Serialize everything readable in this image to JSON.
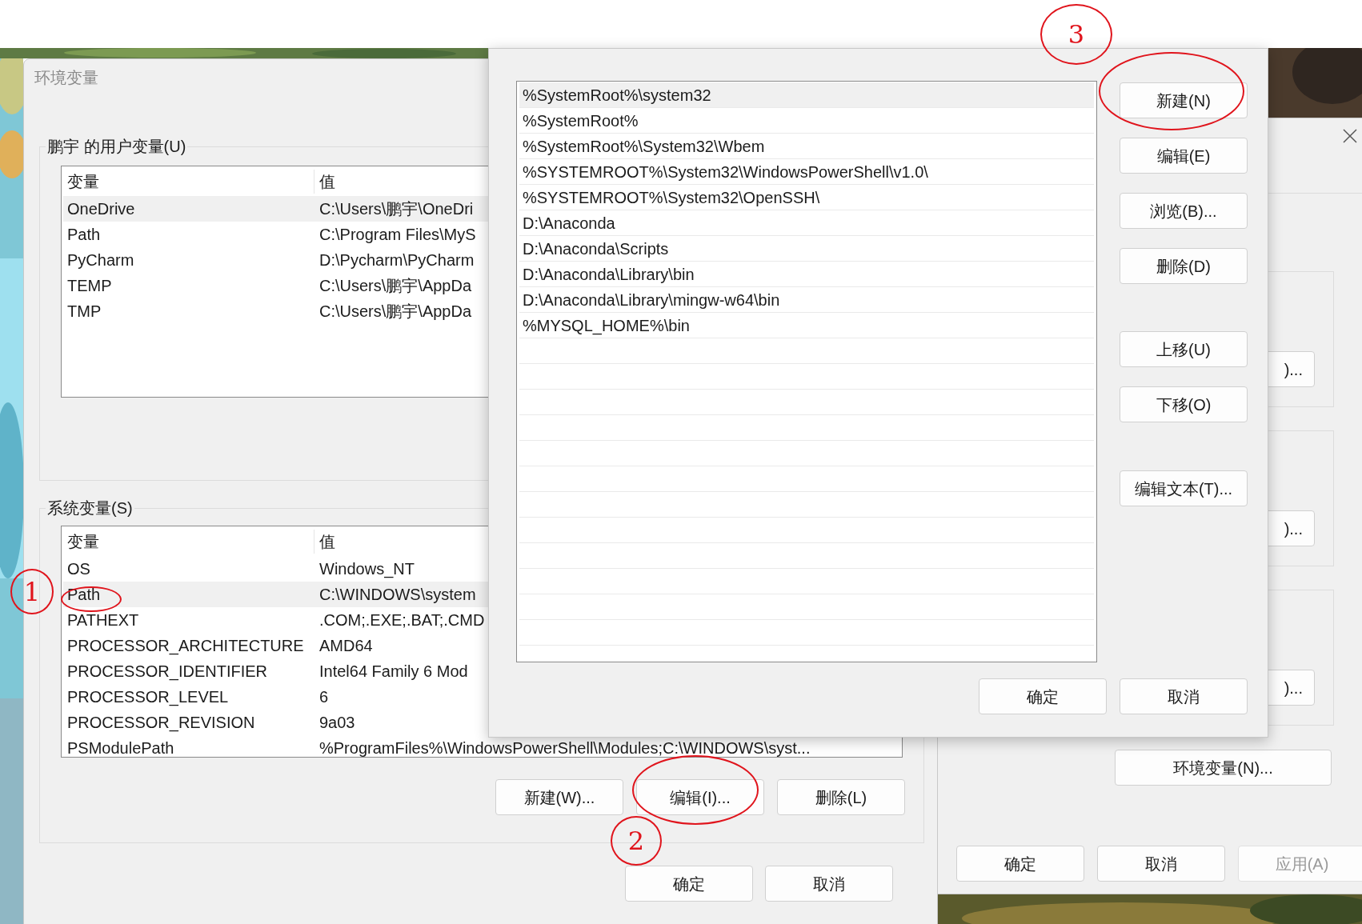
{
  "env_window": {
    "title": "环境变量",
    "user_group": {
      "label": "鹏宇 的用户变量(U)",
      "columns": [
        "变量",
        "值"
      ],
      "rows": [
        {
          "name": "OneDrive",
          "value": "C:\\Users\\鹏宇\\OneDri",
          "selected": true
        },
        {
          "name": "Path",
          "value": "C:\\Program Files\\MyS",
          "selected": false
        },
        {
          "name": "PyCharm",
          "value": "D:\\Pycharm\\PyCharm",
          "selected": false
        },
        {
          "name": "TEMP",
          "value": "C:\\Users\\鹏宇\\AppDa",
          "selected": false
        },
        {
          "name": "TMP",
          "value": "C:\\Users\\鹏宇\\AppDa",
          "selected": false
        }
      ]
    },
    "system_group": {
      "label": "系统变量(S)",
      "columns": [
        "变量",
        "值"
      ],
      "rows": [
        {
          "name": "OS",
          "value": "Windows_NT",
          "selected": false
        },
        {
          "name": "Path",
          "value": "C:\\WINDOWS\\system",
          "selected": true
        },
        {
          "name": "PATHEXT",
          "value": ".COM;.EXE;.BAT;.CMD",
          "selected": false
        },
        {
          "name": "PROCESSOR_ARCHITECTURE",
          "value": "AMD64",
          "selected": false
        },
        {
          "name": "PROCESSOR_IDENTIFIER",
          "value": "Intel64 Family 6 Mod",
          "selected": false
        },
        {
          "name": "PROCESSOR_LEVEL",
          "value": "6",
          "selected": false
        },
        {
          "name": "PROCESSOR_REVISION",
          "value": "9a03",
          "selected": false
        },
        {
          "name": "PSModulePath",
          "value": "%ProgramFiles%\\WindowsPowerShell\\Modules;C:\\WINDOWS\\syst...",
          "selected": false
        }
      ],
      "buttons": [
        "新建(W)...",
        "编辑(I)...",
        "删除(L)"
      ]
    },
    "buttons": [
      "确定",
      "取消"
    ]
  },
  "edit_dialog": {
    "entries": [
      {
        "text": "%SystemRoot%\\system32",
        "selected": true
      },
      {
        "text": "%SystemRoot%",
        "selected": false
      },
      {
        "text": "%SystemRoot%\\System32\\Wbem",
        "selected": false
      },
      {
        "text": "%SYSTEMROOT%\\System32\\WindowsPowerShell\\v1.0\\",
        "selected": false
      },
      {
        "text": "%SYSTEMROOT%\\System32\\OpenSSH\\",
        "selected": false
      },
      {
        "text": "D:\\Anaconda",
        "selected": false
      },
      {
        "text": "D:\\Anaconda\\Scripts",
        "selected": false
      },
      {
        "text": "D:\\Anaconda\\Library\\bin",
        "selected": false
      },
      {
        "text": "D:\\Anaconda\\Library\\mingw-w64\\bin",
        "selected": false
      },
      {
        "text": "%MYSQL_HOME%\\bin",
        "selected": false
      }
    ],
    "side_buttons": [
      "新建(N)",
      "编辑(E)",
      "浏览(B)...",
      "删除(D)",
      "上移(U)",
      "下移(O)",
      "编辑文本(T)..."
    ],
    "buttons": [
      "确定",
      "取消"
    ]
  },
  "back_window": {
    "partial_buttons": [
      ")...",
      ")...",
      ")..."
    ],
    "env_button": "环境变量(N)...",
    "buttons": [
      {
        "label": "确定",
        "disabled": false
      },
      {
        "label": "取消",
        "disabled": false
      },
      {
        "label": "应用(A)",
        "disabled": true
      }
    ]
  },
  "annotations": [
    {
      "label": "1"
    },
    {
      "label": "2"
    },
    {
      "label": "3"
    }
  ]
}
